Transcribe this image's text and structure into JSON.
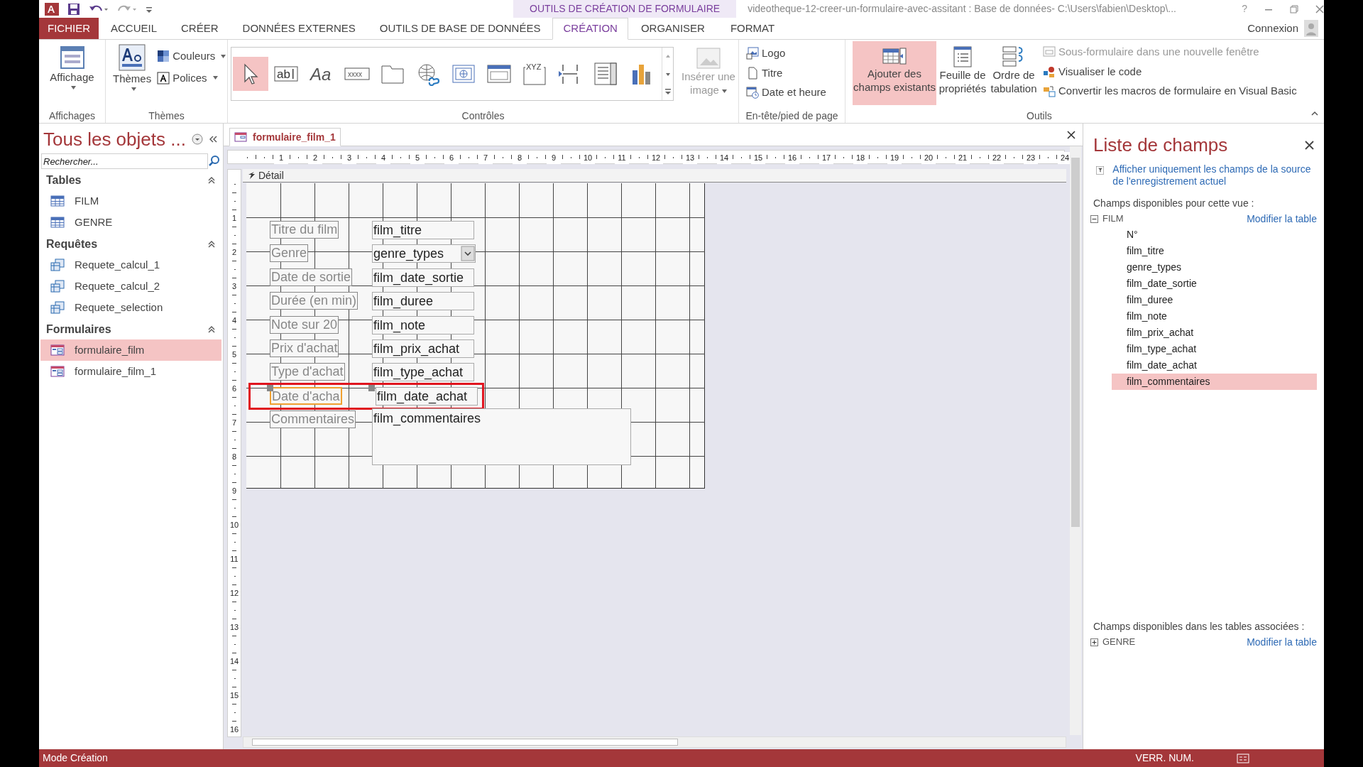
{
  "window": {
    "title": "videotheque-12-creer-un-formulaire-avec-assitant : Base de données- C:\\Users\\fabien\\Desktop\\...",
    "context_group": "OUTILS DE CRÉATION DE FORMULAIRE",
    "help": "?",
    "account": "Connexion"
  },
  "ribbon_tabs": [
    {
      "label": "FICHIER",
      "kind": "file",
      "selected": false
    },
    {
      "label": "ACCUEIL",
      "kind": "normal",
      "selected": false
    },
    {
      "label": "CRÉER",
      "kind": "normal",
      "selected": false
    },
    {
      "label": "DONNÉES EXTERNES",
      "kind": "normal",
      "selected": false
    },
    {
      "label": "OUTILS DE BASE DE DONNÉES",
      "kind": "normal",
      "selected": false
    },
    {
      "label": "CRÉATION",
      "kind": "context",
      "selected": true
    },
    {
      "label": "ORGANISER",
      "kind": "context",
      "selected": false
    },
    {
      "label": "FORMAT",
      "kind": "context",
      "selected": false
    }
  ],
  "ribbon": {
    "views_group": {
      "label": "Affichages",
      "button": "Affichage"
    },
    "themes_group": {
      "label": "Thèmes",
      "button": "Thèmes",
      "options": [
        "Couleurs",
        "Polices"
      ]
    },
    "controls_group": {
      "label": "Contrôles",
      "gallery": [
        {
          "kind": "pointer",
          "selected": true
        },
        {
          "kind": "textbox",
          "glyph": "ab",
          "selected": false
        },
        {
          "kind": "label",
          "glyph": "Aa",
          "selected": false
        },
        {
          "kind": "button",
          "glyph": "xxxx",
          "selected": false
        },
        {
          "kind": "tab",
          "selected": false
        },
        {
          "kind": "hyperlink",
          "selected": false
        },
        {
          "kind": "web",
          "selected": false
        },
        {
          "kind": "navigation",
          "selected": false
        },
        {
          "kind": "group",
          "glyph": "XYZ",
          "selected": false
        },
        {
          "kind": "pagebreak",
          "selected": false
        },
        {
          "kind": "combo",
          "selected": false
        },
        {
          "kind": "chart",
          "selected": false
        }
      ],
      "insert_image": {
        "label": "Insérer une image",
        "disabled": true
      }
    },
    "header_group": {
      "label": "En-tête/pied de page",
      "items": [
        {
          "kind": "logo",
          "label": "Logo"
        },
        {
          "kind": "title",
          "label": "Titre"
        },
        {
          "kind": "datetime",
          "label": "Date et heure"
        }
      ]
    },
    "tools_group": {
      "label": "Outils",
      "large": [
        {
          "kind": "add_fields",
          "label": "Ajouter des champs existants",
          "selected": true
        },
        {
          "kind": "property_sheet",
          "label": "Feuille de propriétés",
          "selected": false
        },
        {
          "kind": "tab_order",
          "label": "Ordre de tabulation",
          "selected": false
        }
      ],
      "small": [
        {
          "kind": "subform",
          "label": "Sous-formulaire dans une nouvelle fenêtre",
          "disabled": true
        },
        {
          "kind": "code",
          "label": "Visualiser le code",
          "disabled": false
        },
        {
          "kind": "macros",
          "label": "Convertir les macros de formulaire en Visual Basic",
          "disabled": false
        }
      ]
    }
  },
  "navigation_pane": {
    "title": "Tous les objets ...",
    "search": {
      "placeholder": "Rechercher..."
    },
    "groups": [
      {
        "title": "Tables",
        "items": [
          {
            "kind": "table",
            "label": "FILM",
            "selected": false
          },
          {
            "kind": "table",
            "label": "GENRE",
            "selected": false
          }
        ]
      },
      {
        "title": "Requêtes",
        "items": [
          {
            "kind": "query",
            "label": "Requete_calcul_1",
            "selected": false
          },
          {
            "kind": "query",
            "label": "Requete_calcul_2",
            "selected": false
          },
          {
            "kind": "query",
            "label": "Requete_selection",
            "selected": false
          }
        ]
      },
      {
        "title": "Formulaires",
        "items": [
          {
            "kind": "form",
            "label": "formulaire_film",
            "selected": true
          },
          {
            "kind": "form",
            "label": "formulaire_film_1",
            "selected": false
          }
        ]
      }
    ]
  },
  "document": {
    "tab": {
      "label": "formulaire_film_1",
      "selected": true
    },
    "section": "Détail",
    "ruler_h": [
      "1",
      "2",
      "3",
      "4",
      "5",
      "6",
      "7",
      "8",
      "9",
      "10",
      "11",
      "12",
      "13",
      "14",
      "15",
      "16",
      "17",
      "18",
      "19",
      "20",
      "21",
      "22",
      "23",
      "24"
    ],
    "ruler_v": [
      "1",
      "2",
      "3",
      "4",
      "5",
      "6",
      "7",
      "8",
      "9",
      "10",
      "11",
      "12",
      "13",
      "14",
      "15",
      "16"
    ],
    "controls": [
      {
        "label": "Titre du film",
        "field": "film_titre",
        "kind": "textbox",
        "selected": false
      },
      {
        "label": "Genre",
        "field": "genre_types",
        "kind": "combo",
        "selected": false
      },
      {
        "label": "Date de sortie",
        "field": "film_date_sortie",
        "kind": "textbox",
        "selected": false
      },
      {
        "label": "Durée (en min)",
        "field": "film_duree",
        "kind": "textbox",
        "selected": false
      },
      {
        "label": "Note sur 20",
        "field": "film_note",
        "kind": "textbox",
        "selected": false
      },
      {
        "label": "Prix d'achat",
        "field": "film_prix_achat",
        "kind": "textbox",
        "selected": false
      },
      {
        "label": "Type d'achat",
        "field": "film_type_achat",
        "kind": "textbox",
        "selected": false
      },
      {
        "label": "Date d'acha",
        "field": "film_date_achat",
        "kind": "textbox",
        "selected": true
      },
      {
        "label": "Commentaires",
        "field": "film_commentaires",
        "kind": "memo",
        "selected": false
      }
    ]
  },
  "field_list": {
    "title": "Liste de champs",
    "filter_link": "Afficher uniquement les champs de la source de l'enregistrement actuel",
    "available": {
      "label": "Champs disponibles pour cette vue :",
      "tables": [
        {
          "name": "FILM",
          "expanded": true,
          "action": "Modifier la table",
          "fields": [
            {
              "label": "N°",
              "selected": false
            },
            {
              "label": "film_titre",
              "selected": false
            },
            {
              "label": "genre_types",
              "selected": false
            },
            {
              "label": "film_date_sortie",
              "selected": false
            },
            {
              "label": "film_duree",
              "selected": false
            },
            {
              "label": "film_note",
              "selected": false
            },
            {
              "label": "film_prix_achat",
              "selected": false
            },
            {
              "label": "film_type_achat",
              "selected": false
            },
            {
              "label": "film_date_achat",
              "selected": false
            },
            {
              "label": "film_commentaires",
              "selected": true
            }
          ]
        }
      ]
    },
    "related": {
      "label": "Champs disponibles dans les tables associées :",
      "tables": [
        {
          "name": "GENRE",
          "expanded": false,
          "action": "Modifier la table"
        }
      ]
    }
  },
  "status_bar": {
    "mode": "Mode Création",
    "indicators": [
      "VERR. NUM."
    ]
  }
}
